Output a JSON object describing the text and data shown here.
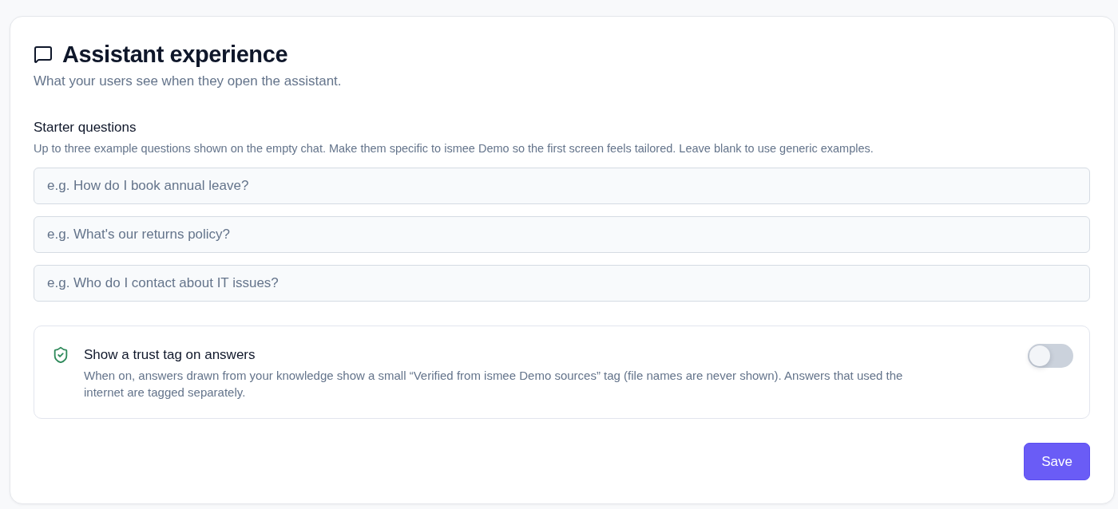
{
  "header": {
    "title": "Assistant experience",
    "subtitle": "What your users see when they open the assistant."
  },
  "starter_questions": {
    "label": "Starter questions",
    "description": "Up to three example questions shown on the empty chat. Make them specific to ismee Demo so the first screen feels tailored. Leave blank to use generic examples.",
    "fields": [
      {
        "placeholder": "e.g. How do I book annual leave?"
      },
      {
        "placeholder": "e.g. What's our returns policy?"
      },
      {
        "placeholder": "e.g. Who do I contact about IT issues?"
      }
    ]
  },
  "trust_tag": {
    "title": "Show a trust tag on answers",
    "description": "When on, answers drawn from your knowledge show a small “Verified from ismee Demo sources” tag (file names are never shown). Answers that used the internet are tagged separately.",
    "on": false
  },
  "save_button": {
    "label": "Save"
  }
}
